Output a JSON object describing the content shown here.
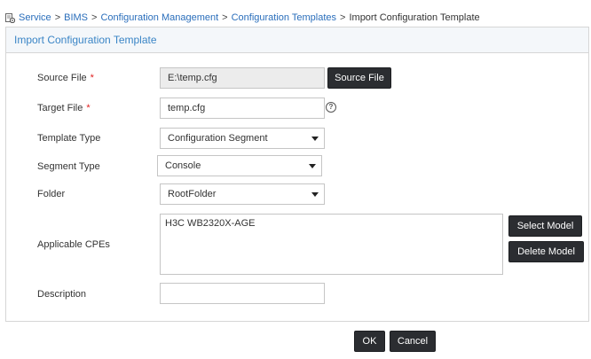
{
  "breadcrumb": {
    "icon": "service-config-icon",
    "items": [
      "Service",
      "BIMS",
      "Configuration Management",
      "Configuration Templates"
    ],
    "separator": ">",
    "current": "Import Configuration Template"
  },
  "panel": {
    "title": "Import Configuration Template"
  },
  "form": {
    "required_mark": "*",
    "source_file": {
      "label": "Source File",
      "value": "E:\\temp.cfg",
      "button": "Source File"
    },
    "target_file": {
      "label": "Target File",
      "value": "temp.cfg",
      "help_icon": "?"
    },
    "template_type": {
      "label": "Template Type",
      "value": "Configuration Segment"
    },
    "segment_type": {
      "label": "Segment Type",
      "value": "Console"
    },
    "folder": {
      "label": "Folder",
      "value": "RootFolder"
    },
    "applicable_cpes": {
      "label": "Applicable CPEs",
      "items": [
        "H3C WB2320X-AGE"
      ],
      "select_button": "Select Model",
      "delete_button": "Delete Model"
    },
    "description": {
      "label": "Description",
      "value": ""
    }
  },
  "actions": {
    "ok": "OK",
    "cancel": "Cancel"
  },
  "colors": {
    "link": "#2a6ebb",
    "header_title": "#3a85c6",
    "required": "#e02020",
    "button_bg": "#2b2d31"
  }
}
